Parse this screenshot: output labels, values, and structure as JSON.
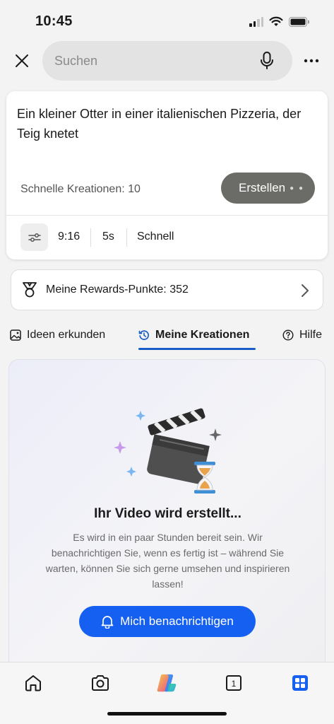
{
  "status_bar": {
    "time": "10:45",
    "icons": [
      "signal-icon",
      "wifi-icon",
      "battery-icon"
    ]
  },
  "top_bar": {
    "search_placeholder": "Suchen",
    "icons": [
      "close-icon",
      "microphone-icon",
      "more-icon"
    ]
  },
  "prompt_card": {
    "prompt": "Ein kleiner Otter in einer italienischen Pizzeria, der Teig knetet",
    "quick_creations": "Schnelle Kreationen: 10",
    "create_button": "Erstellen",
    "options": {
      "aspect_ratio": "9:16",
      "duration": "5s",
      "speed": "Schnell"
    }
  },
  "rewards": {
    "label": "Meine Rewards-Punkte: 352"
  },
  "tabs": [
    {
      "label": "Ideen erkunden",
      "icon": "image-icon",
      "active": false
    },
    {
      "label": "Meine Kreationen",
      "icon": "history-icon",
      "active": true
    },
    {
      "label": "Hilfe",
      "icon": "help-icon",
      "active": false
    }
  ],
  "status": {
    "title": "Ihr Video wird erstellt...",
    "description": "Es wird in ein paar Stunden bereit sein. Wir benachrichtigen Sie, wenn es fertig ist – während Sie warten, können Sie sich gerne umsehen und inspirieren lassen!",
    "notify_button": "Mich benachrichtigen"
  },
  "bottom_nav": {
    "items": [
      "home-icon",
      "camera-icon",
      "copilot-icon",
      "tabs-icon",
      "apps-icon"
    ],
    "tab_count": "1"
  },
  "colors": {
    "accent": "#1560f0",
    "tab_underline": "#1a5dc8",
    "create_button": "#6b6c67"
  }
}
